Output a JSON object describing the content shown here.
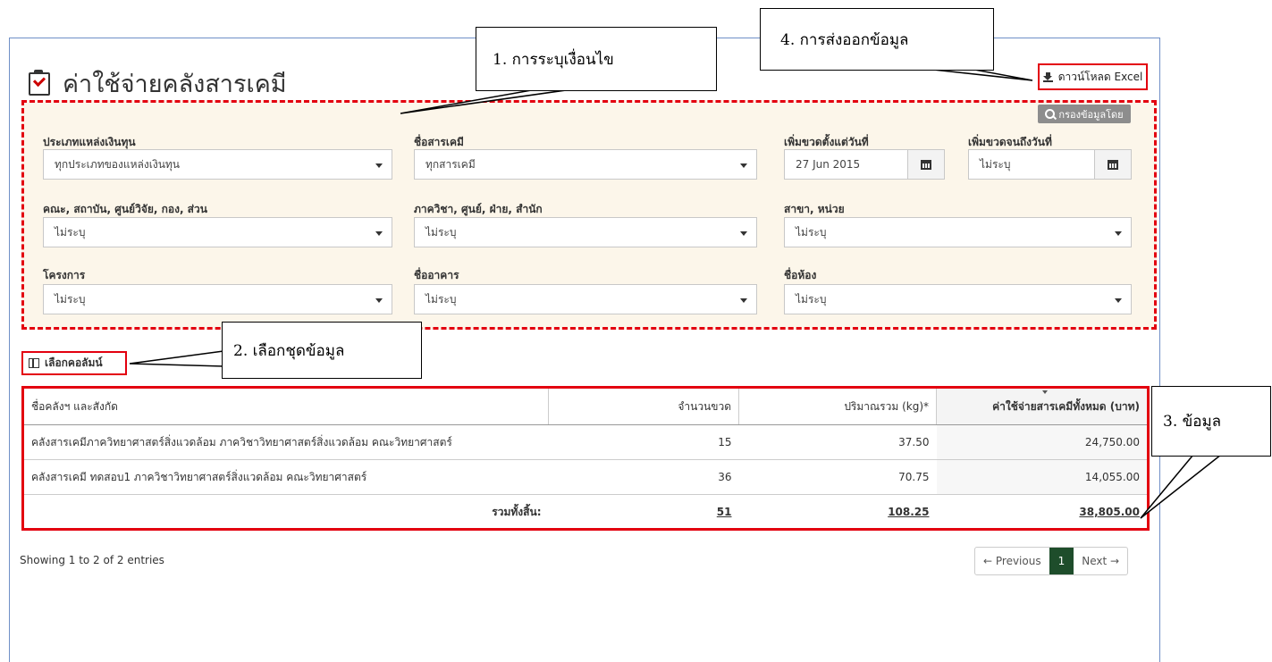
{
  "page": {
    "title": "ค่าใช้จ่ายคลังสารเคมี",
    "excel_button": "ดาวน์โหลด Excel",
    "filter_badge": "กรองข้อมูลโดย"
  },
  "filters": {
    "funding_type": {
      "label": "ประเภทแหล่งเงินทุน",
      "value": "ทุกประเภทของแหล่งเงินทุน"
    },
    "chemical_name": {
      "label": "ชื่อสารเคมี",
      "value": "ทุกสารเคมี"
    },
    "date_from": {
      "label": "เพิ่มขวดตั้งแต่วันที่",
      "value": "27 Jun 2015"
    },
    "date_to": {
      "label": "เพิ่มขวดจนถึงวันที่",
      "value": "ไม่ระบุ"
    },
    "faculty": {
      "label": "คณะ, สถาบัน, ศูนย์วิจัย, กอง, ส่วน",
      "value": "ไม่ระบุ"
    },
    "department": {
      "label": "ภาควิชา, ศูนย์, ฝ่าย, สำนัก",
      "value": "ไม่ระบุ"
    },
    "branch": {
      "label": "สาขา, หน่วย",
      "value": "ไม่ระบุ"
    },
    "project": {
      "label": "โครงการ",
      "value": "ไม่ระบุ"
    },
    "building": {
      "label": "ชื่ออาคาร",
      "value": "ไม่ระบุ"
    },
    "room": {
      "label": "ชื่อห้อง",
      "value": "ไม่ระบุ"
    }
  },
  "columns_button": "เลือกคอลัมน์",
  "table": {
    "headers": [
      "ชื่อคลังฯ และสังกัด",
      "จำนวนขวด",
      "ปริมาณรวม (kg)*",
      "ค่าใช้จ่ายสารเคมีทั้งหมด (บาท)"
    ],
    "rows": [
      {
        "name": "คลังสารเคมีภาควิทยาศาสตร์สิ่งแวดล้อม ภาควิชาวิทยาศาสตร์สิ่งแวดล้อม คณะวิทยาศาสตร์",
        "bottles": "15",
        "qty": "37.50",
        "cost": "24,750.00"
      },
      {
        "name": "คลังสารเคมี ทดสอบ1 ภาควิชาวิทยาศาสตร์สิ่งแวดล้อม คณะวิทยาศาสตร์",
        "bottles": "36",
        "qty": "70.75",
        "cost": "14,055.00"
      }
    ],
    "total": {
      "label": "รวมทั้งสิ้น:",
      "bottles": "51",
      "qty": "108.25",
      "cost": "38,805.00"
    }
  },
  "info": "Showing 1 to 2 of 2 entries",
  "pager": {
    "prev": "← Previous",
    "current": "1",
    "next": "Next →"
  },
  "callouts": {
    "c1": "1. การระบุเงื่อนไข",
    "c2": "2. เลือกชุดข้อมูล",
    "c3": "3. ข้อมูล",
    "c4": "4. การส่งออกข้อมูล"
  },
  "colors": {
    "accent_red": "#e3000f",
    "panel_bg": "#fcf6ea",
    "pager_active": "#1e4d2b"
  }
}
